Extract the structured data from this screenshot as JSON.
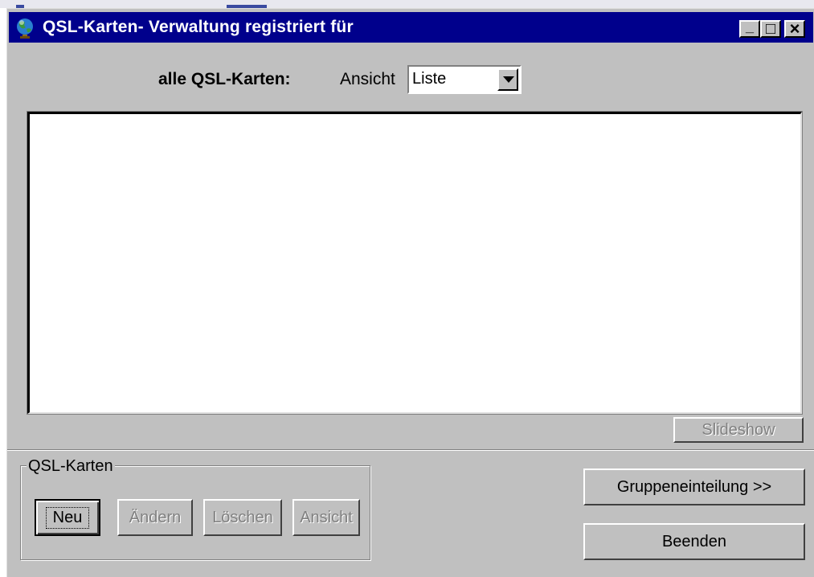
{
  "window": {
    "title": "QSL-Karten- Verwaltung  registriert für",
    "minimize_symbol": "_",
    "maximize_symbol": "□",
    "close_symbol": "×"
  },
  "header": {
    "all_cards_label": "alle QSL-Karten:",
    "view_label": "Ansicht",
    "view_value": "Liste"
  },
  "list": {
    "items": []
  },
  "buttons": {
    "slideshow": "Slideshow",
    "group": "Gruppeneinteilung >>",
    "quit": "Beenden"
  },
  "cards_group": {
    "title": "QSL-Karten",
    "new": "Neu",
    "edit": "Ändern",
    "delete": "Löschen",
    "view": "Ansicht"
  },
  "icons": {
    "app": "globe-icon",
    "combo_arrow": "chevron-down-icon"
  },
  "colors": {
    "titlebar": "#00008c",
    "face": "#c0c0c0",
    "disabled_text": "#808080"
  }
}
